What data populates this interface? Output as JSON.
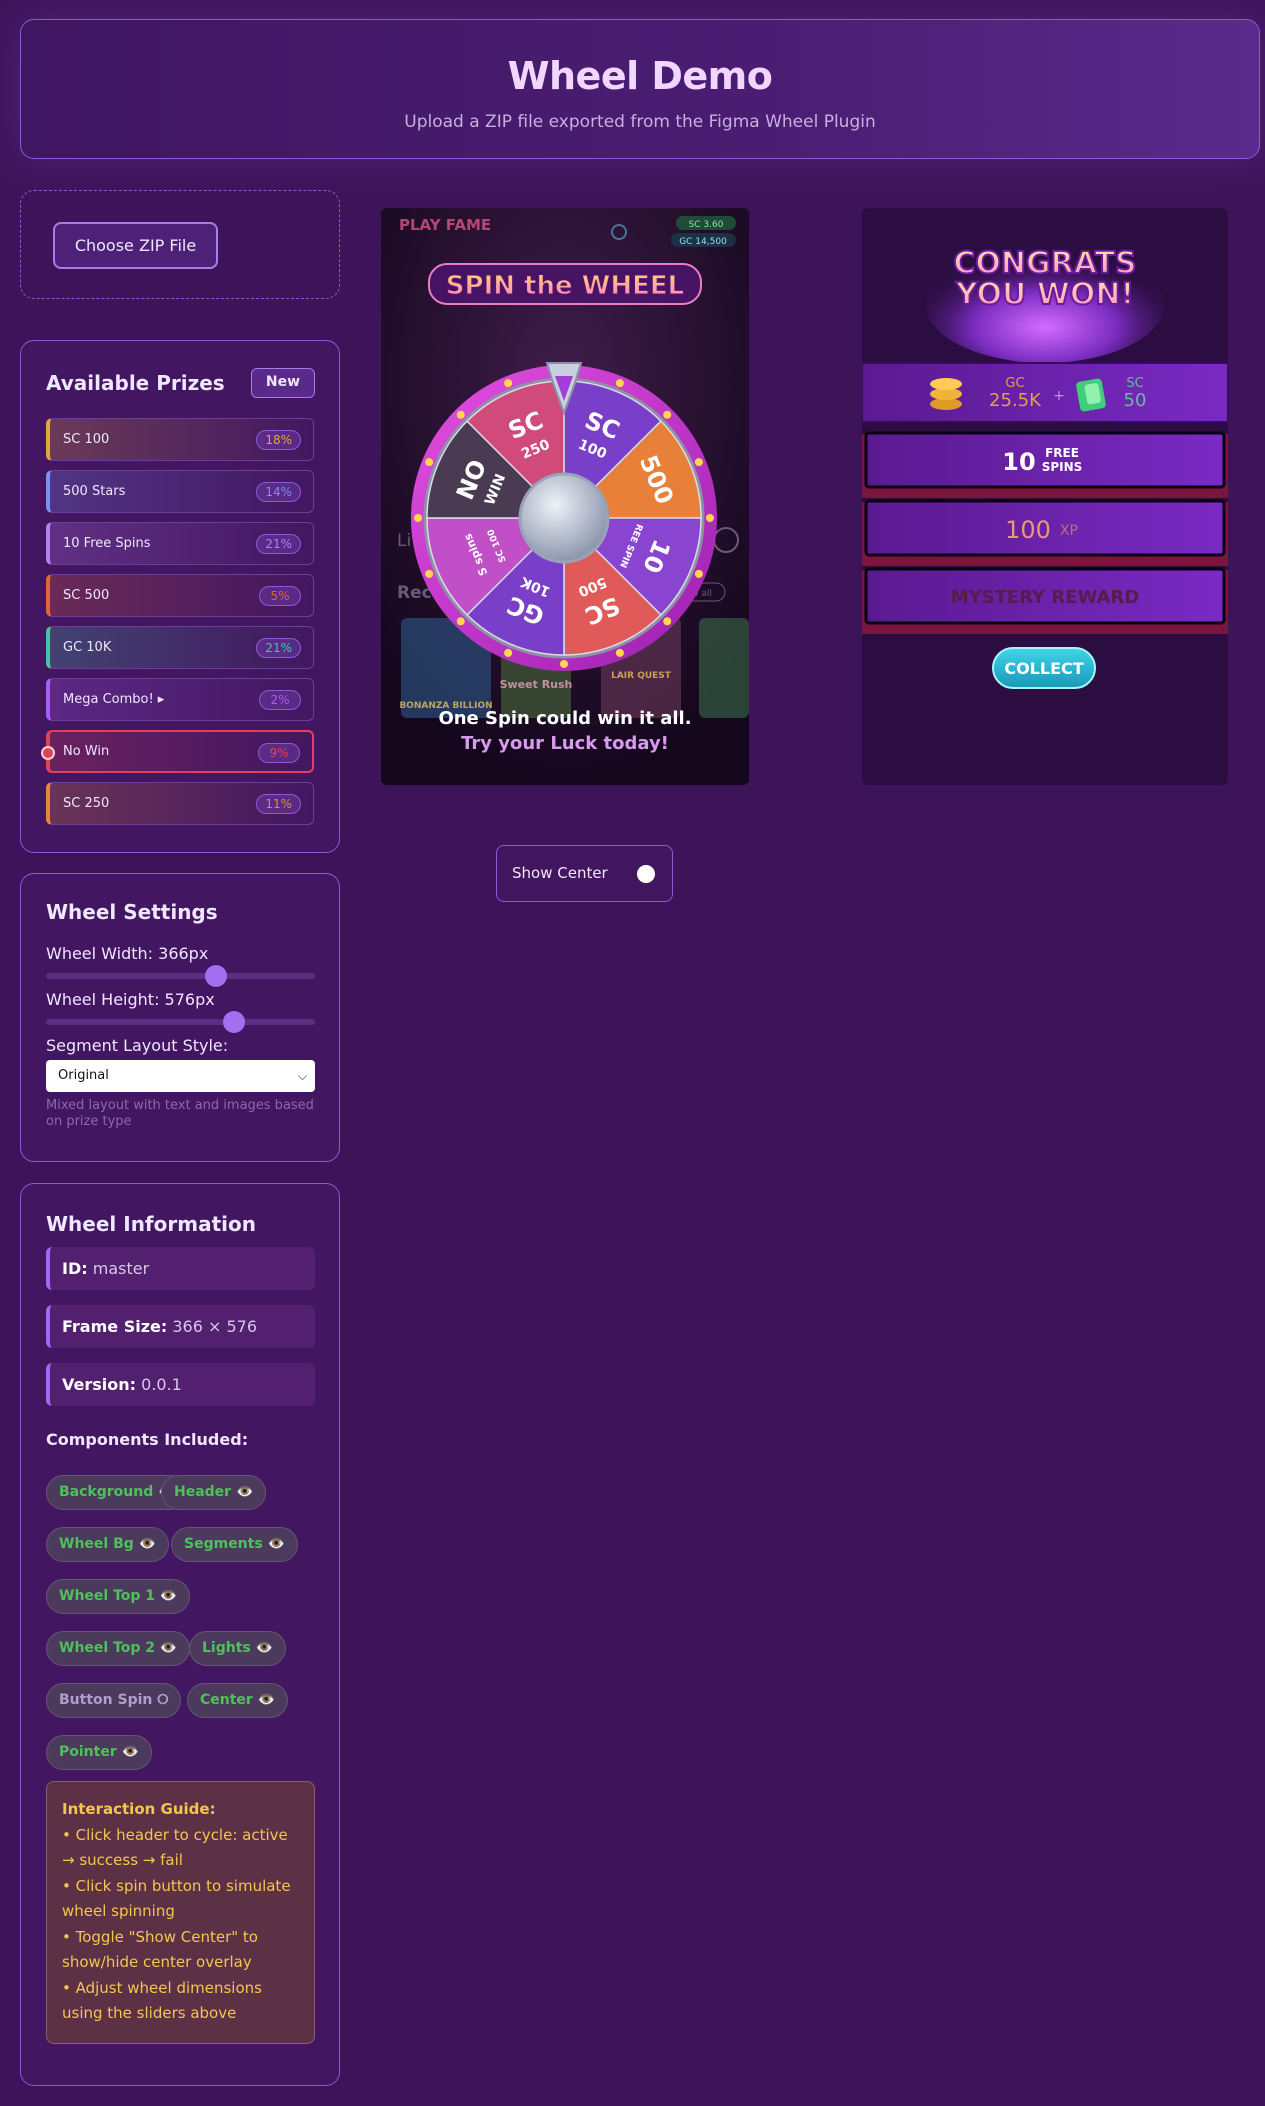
{
  "header": {
    "title": "Wheel Demo",
    "subtitle": "Upload a ZIP file exported from the Figma Wheel Plugin"
  },
  "upload": {
    "button_label": "Choose ZIP File"
  },
  "prizes": {
    "title": "Available Prizes",
    "new_label": "New",
    "items": [
      {
        "label": "SC 100",
        "pct": "18%",
        "color": "#e0a83a"
      },
      {
        "label": "500 Stars",
        "pct": "14%",
        "color": "#7d8ff0"
      },
      {
        "label": "10 Free Spins",
        "pct": "21%",
        "color": "#b97ef0"
      },
      {
        "label": "SC 500",
        "pct": "5%",
        "color": "#e0663a"
      },
      {
        "label": "GC 10K",
        "pct": "21%",
        "color": "#3fc7a4"
      },
      {
        "label": "Mega Combo! ▸",
        "pct": "2%",
        "color": "#a85ef0"
      },
      {
        "label": "No Win",
        "pct": "9%",
        "color": "#e0425a"
      },
      {
        "label": "SC 250",
        "pct": "11%",
        "color": "#e08a3a"
      }
    ]
  },
  "settings": {
    "title": "Wheel Settings",
    "width_label": "Wheel Width: 366px",
    "width_value": 366,
    "height_label": "Wheel Height: 576px",
    "height_value": 576,
    "layout_label": "Segment Layout Style:",
    "layout_value": "Original",
    "layout_hint": "Mixed layout with text and images based on prize type"
  },
  "info": {
    "title": "Wheel Information",
    "id_label": "ID:",
    "id_value": "master",
    "frame_label": "Frame Size:",
    "frame_value": "366 × 576",
    "version_label": "Version:",
    "version_value": "0.0.1",
    "components_title": "Components Included:",
    "components": [
      {
        "label": "Background 👁️",
        "active": true
      },
      {
        "label": "Header 👁️",
        "active": true
      },
      {
        "label": "Wheel Bg 👁️",
        "active": true
      },
      {
        "label": "Segments 👁️",
        "active": true
      },
      {
        "label": "Wheel Top 1 👁️",
        "active": true
      },
      {
        "label": "Wheel Top 2 👁️",
        "active": true
      },
      {
        "label": "Lights 👁️",
        "active": true
      },
      {
        "label": "Button Spin ⭘",
        "active": false
      },
      {
        "label": "Center 👁️",
        "active": true
      },
      {
        "label": "Pointer 👁️",
        "active": true
      }
    ],
    "guide_title": "Interaction Guide:",
    "guide_lines": [
      "• Click header to cycle: active → success → fail",
      "• Click spin button to simulate wheel spinning",
      "• Toggle \"Show Center\" to show/hide center overlay",
      "• Adjust wheel dimensions using the sliders above"
    ]
  },
  "wheel": {
    "brand": "PLAY FAME",
    "sc_balance": "SC 3.60",
    "gc_balance": "GC 14,500",
    "banner": "SPIN the WHEEL",
    "segments": [
      {
        "top": "SC",
        "bottom": "100",
        "color": "#7a3fc8"
      },
      {
        "top": "500",
        "bottom": "",
        "color": "#e8803a"
      },
      {
        "top": "10",
        "bottom": "REE SPIN",
        "color": "#8a45d0"
      },
      {
        "top": "SC",
        "bottom": "500",
        "color": "#e05a5a"
      },
      {
        "top": "GC",
        "bottom": "10K",
        "color": "#7a3fc8"
      },
      {
        "top": "S spins",
        "bottom": "SC 100",
        "color": "#c04fc8"
      },
      {
        "top": "NO",
        "bottom": "WIN",
        "color": "#4a3a52"
      },
      {
        "top": "SC",
        "bottom": "250",
        "color": "#d04a7a"
      }
    ],
    "bg_words": [
      "Live",
      "Rec",
      "view all",
      "BONANZA BILLION",
      "Sweet Rush",
      "LAIR QUEST"
    ],
    "tagline_1": "One Spin could win it all.",
    "tagline_2": "Try your Luck today!"
  },
  "congrats": {
    "title_1": "CONGRATS",
    "title_2": "YOU WON!",
    "gc_label": "GC",
    "gc_value": "25.5K",
    "plus": "+",
    "sc_label": "SC",
    "sc_value": "50",
    "spins_value": "10",
    "spins_label_1": "FREE",
    "spins_label_2": "SPINS",
    "xp_value": "100",
    "xp_label": "XP",
    "mystery_label": "MYSTERY REWARD",
    "collect_label": "COLLECT"
  },
  "show_center": {
    "label": "Show Center",
    "on": false
  }
}
